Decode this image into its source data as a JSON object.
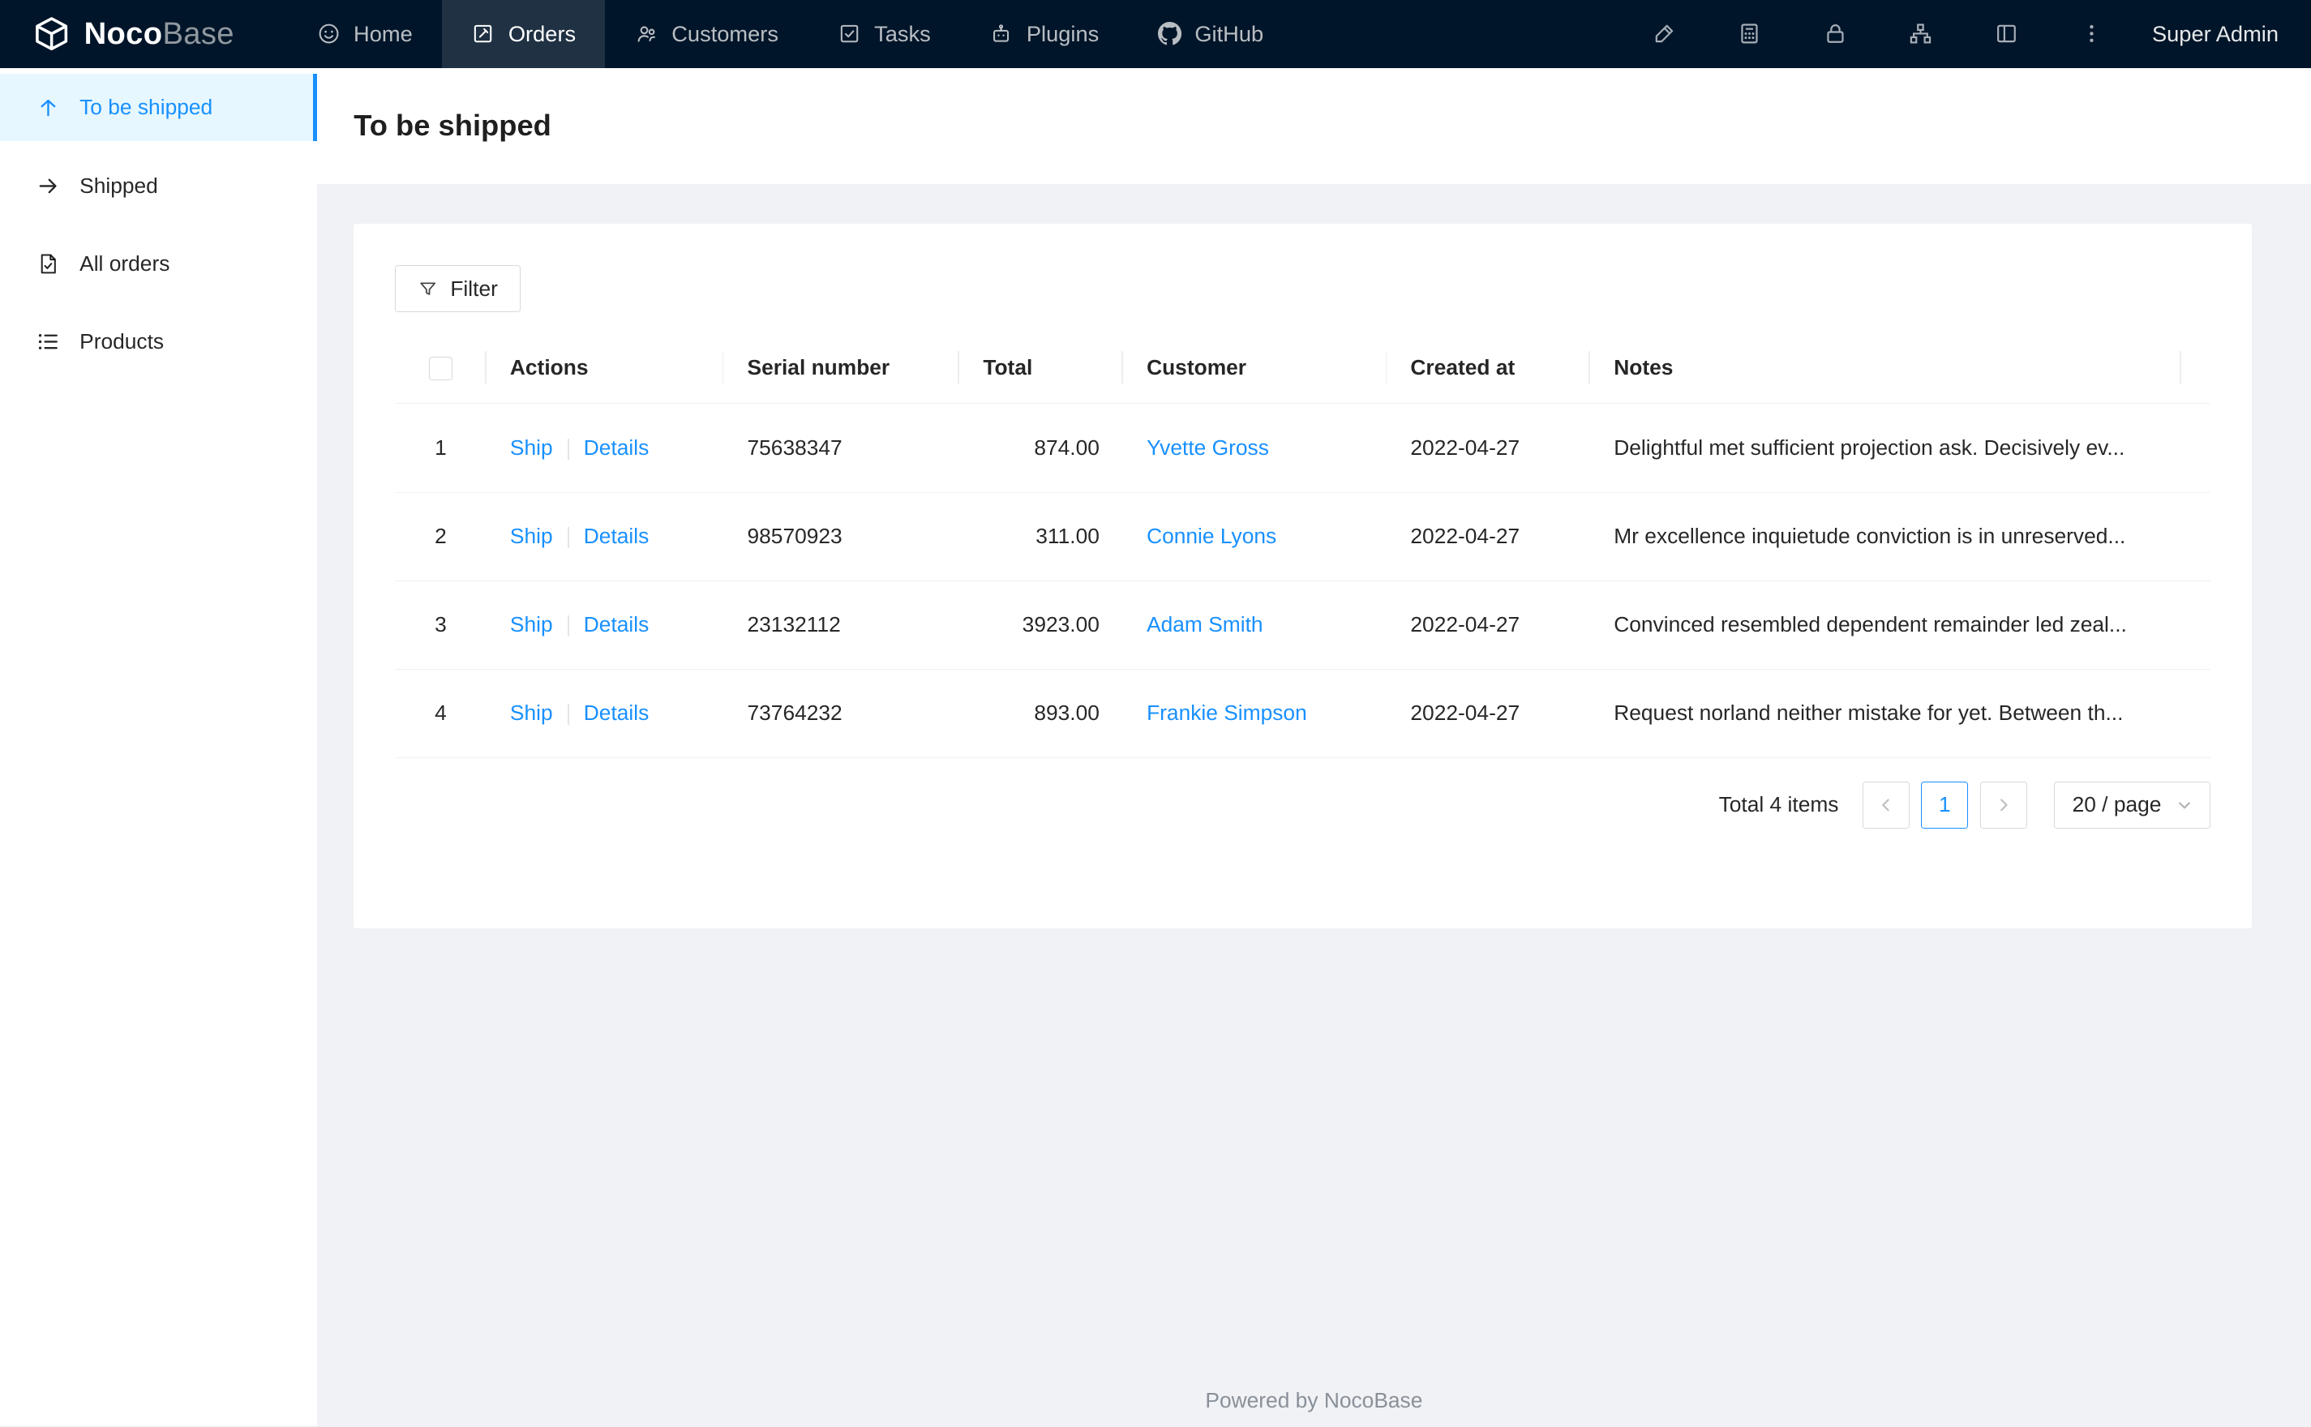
{
  "navbar": {
    "logo": {
      "noco": "Noco",
      "base": "Base"
    },
    "items": [
      {
        "label": "Home"
      },
      {
        "label": "Orders"
      },
      {
        "label": "Customers"
      },
      {
        "label": "Tasks"
      },
      {
        "label": "Plugins"
      },
      {
        "label": "GitHub"
      }
    ],
    "user": "Super Admin"
  },
  "sidebar": {
    "items": [
      {
        "label": "To be shipped"
      },
      {
        "label": "Shipped"
      },
      {
        "label": "All orders"
      },
      {
        "label": "Products"
      }
    ]
  },
  "page": {
    "title": "To be shipped"
  },
  "toolbar": {
    "filter_label": "Filter"
  },
  "table": {
    "columns": [
      "Actions",
      "Serial number",
      "Total",
      "Customer",
      "Created at",
      "Notes"
    ],
    "action_labels": {
      "ship": "Ship",
      "details": "Details"
    },
    "rows": [
      {
        "index": "1",
        "serial": "75638347",
        "total": "874.00",
        "customer": "Yvette Gross",
        "created": "2022-04-27",
        "notes": "Delightful met sufficient projection ask. Decisively ev..."
      },
      {
        "index": "2",
        "serial": "98570923",
        "total": "311.00",
        "customer": "Connie Lyons",
        "created": "2022-04-27",
        "notes": "Mr excellence inquietude conviction is in unreserved..."
      },
      {
        "index": "3",
        "serial": "23132112",
        "total": "3923.00",
        "customer": "Adam Smith",
        "created": "2022-04-27",
        "notes": "Convinced resembled dependent remainder led zeal..."
      },
      {
        "index": "4",
        "serial": "73764232",
        "total": "893.00",
        "customer": "Frankie Simpson",
        "created": "2022-04-27",
        "notes": "Request norland neither mistake for yet. Between th..."
      }
    ]
  },
  "pagination": {
    "total_text": "Total 4 items",
    "current_page": "1",
    "page_size": "20 / page"
  },
  "footer": {
    "text": "Powered by NocoBase"
  },
  "colors": {
    "accent": "#1890ff",
    "navbar_bg": "#001529",
    "selected_bg": "#e6f7ff"
  }
}
